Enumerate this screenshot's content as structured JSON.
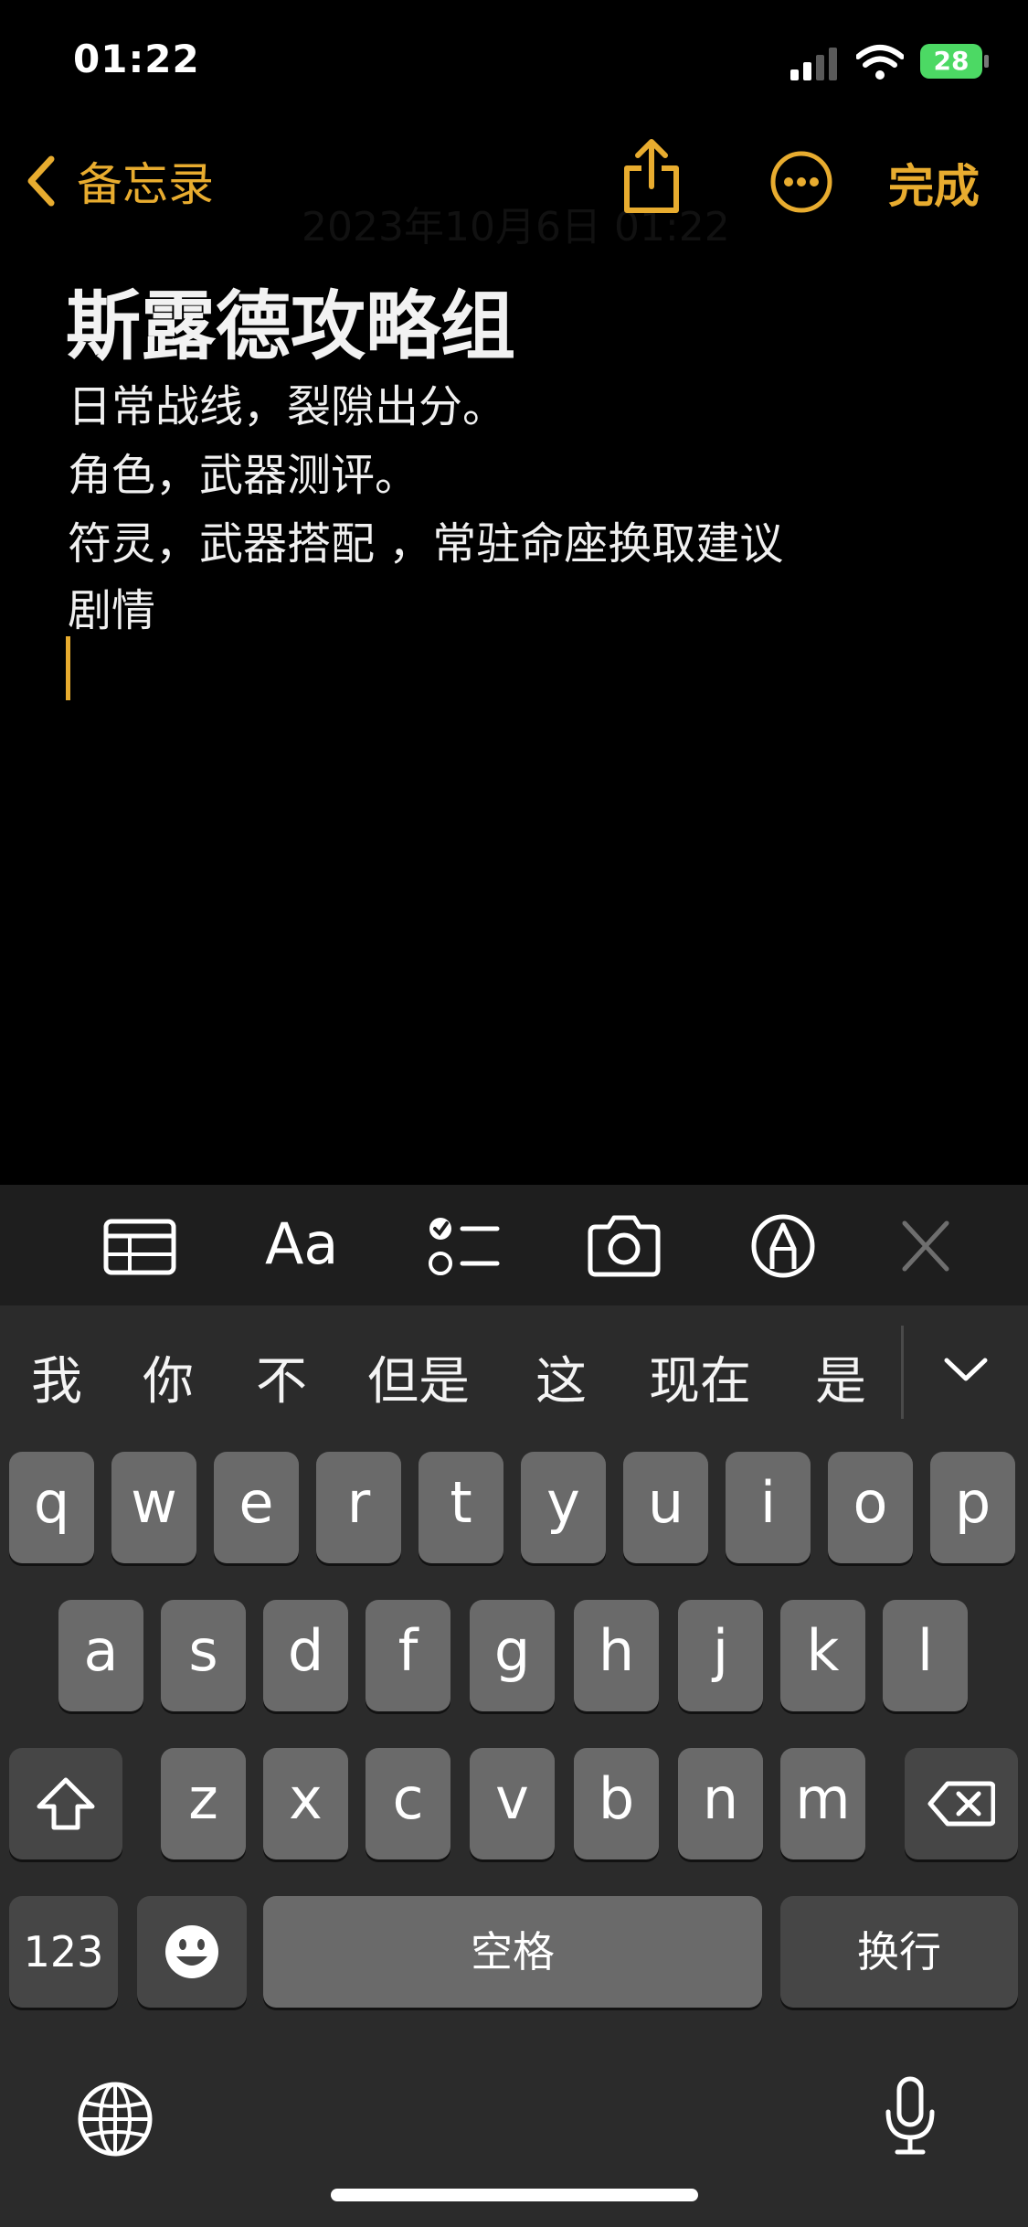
{
  "status_bar": {
    "time": "01:22",
    "battery": "28"
  },
  "nav": {
    "back_label": "备忘录",
    "date": "2023年10月6日 01:22",
    "done_label": "完成"
  },
  "note": {
    "title": "斯露德攻略组",
    "lines": [
      "日常战线，裂隙出分。",
      "角色，武器测评。",
      "符灵，武器搭配 ，常驻命座换取建议",
      "剧情"
    ]
  },
  "toolbar": {
    "format_label": "Aa"
  },
  "candidates": [
    "我",
    "你",
    "不",
    "但是",
    "这",
    "现在",
    "是"
  ],
  "keyboard": {
    "row1": [
      "q",
      "w",
      "e",
      "r",
      "t",
      "y",
      "u",
      "i",
      "o",
      "p"
    ],
    "row2": [
      "a",
      "s",
      "d",
      "f",
      "g",
      "h",
      "j",
      "k",
      "l"
    ],
    "row3": [
      "z",
      "x",
      "c",
      "v",
      "b",
      "n",
      "m"
    ],
    "numbers_label": "123",
    "space_label": "空格",
    "return_label": "换行"
  },
  "colors": {
    "accent": "#e8ac2f",
    "background": "#000000",
    "key": "#6a6a6a",
    "key_dark": "#464646",
    "keyboard_bg": "#2b2b2b",
    "battery": "#4cd964"
  },
  "icons": [
    "chevron-left-icon",
    "share-icon",
    "more-icon",
    "table-icon",
    "checklist-icon",
    "camera-icon",
    "markup-icon",
    "close-icon",
    "chevron-down-icon",
    "shift-icon",
    "delete-icon",
    "emoji-icon",
    "globe-icon",
    "microphone-icon"
  ]
}
